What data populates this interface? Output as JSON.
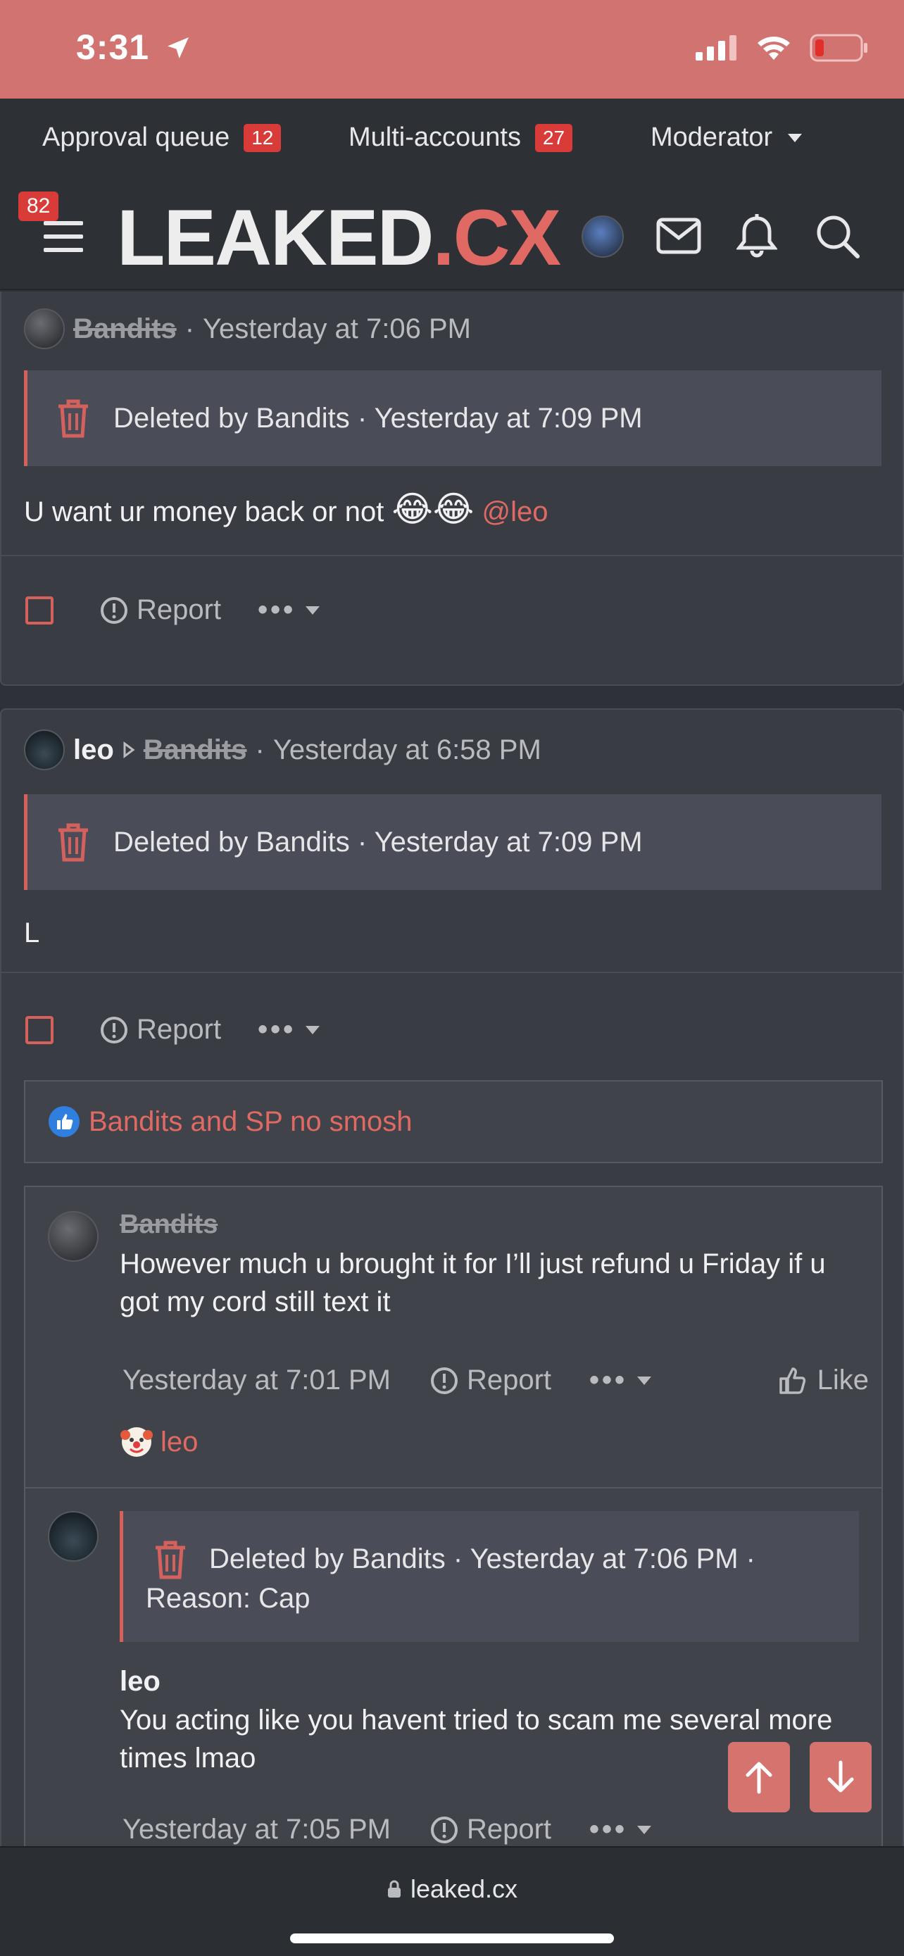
{
  "status_bar": {
    "time": "3:31"
  },
  "mod_nav": {
    "approval_queue": {
      "label": "Approval queue",
      "count": "12"
    },
    "multi_accounts": {
      "label": "Multi-accounts",
      "count": "27"
    },
    "moderator": {
      "label": "Moderator"
    }
  },
  "header": {
    "menu_badge": "82",
    "logo_main": "LEAKED",
    "logo_accent": ".CX"
  },
  "posts": [
    {
      "author": "Bandits",
      "separator": "·",
      "time": "Yesterday at 7:06 PM",
      "deleted_notice": "Deleted by Bandits · Yesterday at 7:09 PM",
      "body": "U want ur money back or not",
      "emojis": "😂😂",
      "mention": "@leo",
      "report_label": "Report"
    },
    {
      "author": "leo",
      "recipient": "Bandits",
      "separator": "·",
      "time": "Yesterday at 6:58 PM",
      "deleted_notice": "Deleted by Bandits · Yesterday at 7:09 PM",
      "body": "L",
      "report_label": "Report",
      "reactions": "Bandits and SP no smosh"
    }
  ],
  "comments": [
    {
      "author": "Bandits",
      "body": "However much u brought it for I’ll just refund u Friday if u got my cord still text it",
      "time": "Yesterday at 7:01 PM",
      "report_label": "Report",
      "like_label": "Like",
      "reaction_user": "leo"
    },
    {
      "deleted_notice": "Deleted by Bandits · Yesterday at 7:06 PM ·",
      "deleted_reason": "Reason: Cap",
      "author": "leo",
      "body": "You acting like you havent tried to scam me several more times lmao",
      "time": "Yesterday at 7:05 PM",
      "report_label": "Report"
    }
  ],
  "browser": {
    "url": "leaked.cx"
  },
  "colors": {
    "accent": "#d5615d",
    "status_bar": "#d07371",
    "badge": "#d93b38"
  }
}
